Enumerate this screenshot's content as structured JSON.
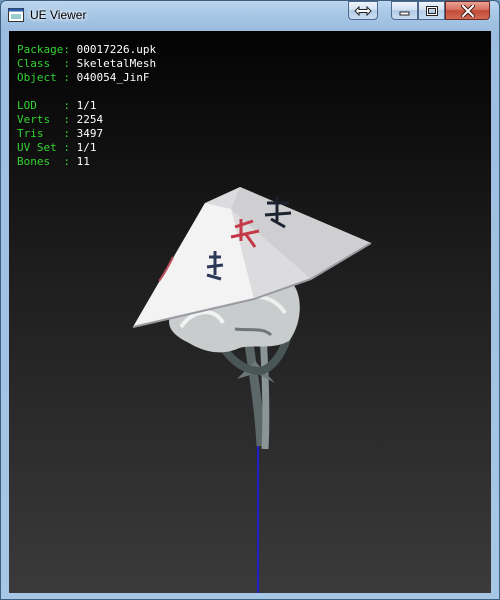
{
  "window": {
    "title": "UE Viewer"
  },
  "info_top": [
    {
      "key": "Package",
      "value": "00017226.upk"
    },
    {
      "key": "Class  ",
      "value": "SkeletalMesh"
    },
    {
      "key": "Object ",
      "value": "040054_JinF"
    }
  ],
  "info_stats": [
    {
      "key": "LOD    ",
      "value": "1/1"
    },
    {
      "key": "Verts  ",
      "value": "2254"
    },
    {
      "key": "Tris   ",
      "value": "3497"
    },
    {
      "key": "UV Set ",
      "value": "1/1"
    },
    {
      "key": "Bones  ",
      "value": "11"
    }
  ],
  "colors": {
    "label": "#32d232",
    "value": "#ffffff",
    "axis": "#2020c8",
    "close_button": "#c44c39"
  }
}
